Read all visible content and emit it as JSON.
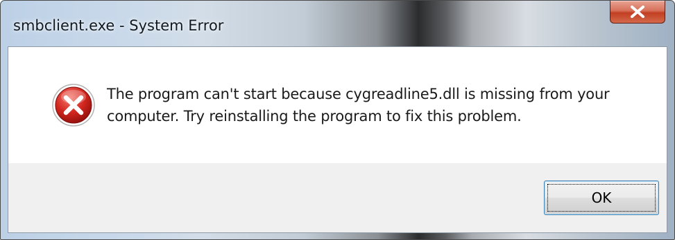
{
  "window": {
    "title": "smbclient.exe - System Error",
    "close_icon": "close-x-icon"
  },
  "dialog": {
    "icon": "error-icon",
    "message": "The program can't start because cygreadline5.dll is missing from your computer. Try reinstalling the program to fix this problem.",
    "ok_label": "OK"
  },
  "colors": {
    "error_red": "#c8211d",
    "close_red": "#c23e22",
    "button_border": "#3c7fb1"
  }
}
